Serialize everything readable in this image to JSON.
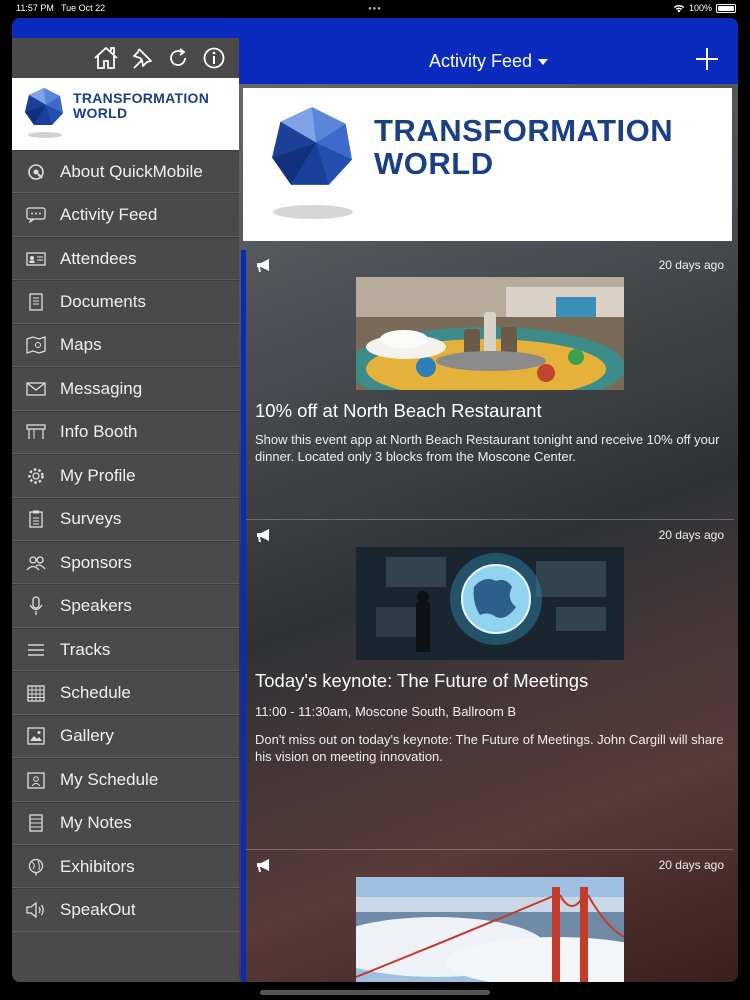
{
  "status_bar": {
    "time": "11:57 PM",
    "date": "Tue Oct 22",
    "battery": "100%"
  },
  "sidebar": {
    "toolbar_icons": [
      "home-icon",
      "pin-icon",
      "refresh-icon",
      "info-icon"
    ],
    "logo_text_line1": "TRANSFORMATION",
    "logo_text_line2": "WORLD",
    "items": [
      {
        "label": "About QuickMobile",
        "icon": "quickmobile-icon"
      },
      {
        "label": "Activity Feed",
        "icon": "chat-icon"
      },
      {
        "label": "Attendees",
        "icon": "id-card-icon"
      },
      {
        "label": "Documents",
        "icon": "document-icon"
      },
      {
        "label": "Maps",
        "icon": "map-icon"
      },
      {
        "label": "Messaging",
        "icon": "envelope-icon"
      },
      {
        "label": "Info Booth",
        "icon": "booth-icon"
      },
      {
        "label": "My Profile",
        "icon": "gear-icon"
      },
      {
        "label": "Surveys",
        "icon": "clipboard-icon"
      },
      {
        "label": "Sponsors",
        "icon": "people-icon"
      },
      {
        "label": "Speakers",
        "icon": "microphone-icon"
      },
      {
        "label": "Tracks",
        "icon": "list-icon"
      },
      {
        "label": "Schedule",
        "icon": "calendar-icon"
      },
      {
        "label": "Gallery",
        "icon": "image-icon"
      },
      {
        "label": "My Schedule",
        "icon": "person-calendar-icon"
      },
      {
        "label": "My Notes",
        "icon": "notes-icon"
      },
      {
        "label": "Exhibitors",
        "icon": "globe-icon"
      },
      {
        "label": "SpeakOut",
        "icon": "speaker-icon"
      }
    ]
  },
  "header": {
    "title": "Activity Feed",
    "add_icon": "plus-icon"
  },
  "banner": {
    "logo_text_line1": "TRANSFORMATION",
    "logo_text_line2": "WORLD"
  },
  "feed": [
    {
      "ago": "20 days ago",
      "title": "10% off at North Beach Restaurant",
      "subtitle": "",
      "body": "Show this event app at North Beach Restaurant tonight and receive 10% off your dinner. Located only 3 blocks from the Moscone Center."
    },
    {
      "ago": "20 days ago",
      "title": "Today's keynote: The Future of Meetings",
      "subtitle": "11:00 - 11:30am, Moscone South, Ballroom B",
      "body": "Don't miss out on today's keynote: The Future of Meetings. John Cargill will share his vision on meeting innovation."
    },
    {
      "ago": "20 days ago",
      "title": "",
      "subtitle": "",
      "body": ""
    }
  ],
  "colors": {
    "brand_blue": "#0a2bbd",
    "logo_navy": "#1a3f87",
    "sidebar_bg": "#4a4a4a"
  }
}
